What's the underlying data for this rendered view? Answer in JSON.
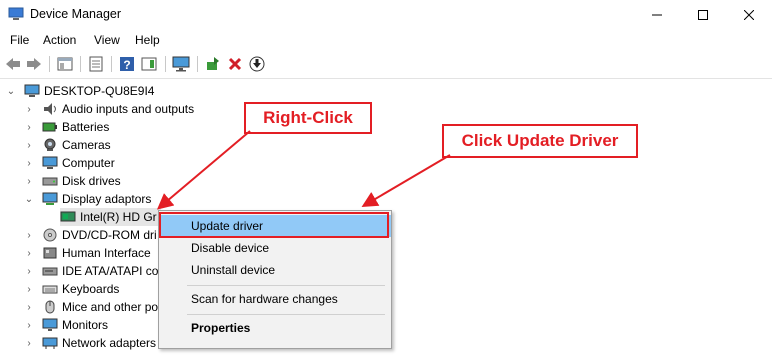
{
  "window": {
    "title": "Device Manager"
  },
  "menu": [
    "File",
    "Action",
    "View",
    "Help"
  ],
  "toolbar_icons": [
    "back-icon",
    "forward-icon",
    "show-hide-icon",
    "properties-icon",
    "help-icon",
    "action-pane-icon",
    "monitor-icon",
    "update-driver-icon",
    "uninstall-icon",
    "download-icon"
  ],
  "tree": {
    "root": "DESKTOP-QU8E9I4",
    "items": [
      {
        "label": "Audio inputs and outputs",
        "icon": "speaker-icon",
        "expanded": false
      },
      {
        "label": "Batteries",
        "icon": "battery-icon",
        "expanded": false
      },
      {
        "label": "Cameras",
        "icon": "camera-icon",
        "expanded": false
      },
      {
        "label": "Computer",
        "icon": "computer-icon",
        "expanded": false
      },
      {
        "label": "Disk drives",
        "icon": "disk-icon",
        "expanded": false
      },
      {
        "label": "Display adaptors",
        "icon": "display-icon",
        "expanded": true
      },
      {
        "label": "Intel(R) HD Gr",
        "icon": "display-card-icon",
        "child": true
      },
      {
        "label": "DVD/CD-ROM dri",
        "icon": "dvd-icon",
        "expanded": false
      },
      {
        "label": "Human Interface",
        "icon": "hid-icon",
        "expanded": false
      },
      {
        "label": "IDE ATA/ATAPI co",
        "icon": "ide-icon",
        "expanded": false
      },
      {
        "label": "Keyboards",
        "icon": "keyboard-icon",
        "expanded": false
      },
      {
        "label": "Mice and other po",
        "icon": "mouse-icon",
        "expanded": false
      },
      {
        "label": "Monitors",
        "icon": "monitor-icon",
        "expanded": false
      },
      {
        "label": "Network adapters",
        "icon": "network-icon",
        "expanded": false
      }
    ]
  },
  "context_menu": {
    "items": [
      "Update driver",
      "Disable device",
      "Uninstall device",
      "Scan for hardware changes",
      "Properties"
    ],
    "highlighted": "Update driver"
  },
  "annotations": {
    "right_click": "Right-Click",
    "update": "Click Update Driver"
  },
  "colors": {
    "accent_red": "#e31e24",
    "highlight": "#91c9f7"
  }
}
